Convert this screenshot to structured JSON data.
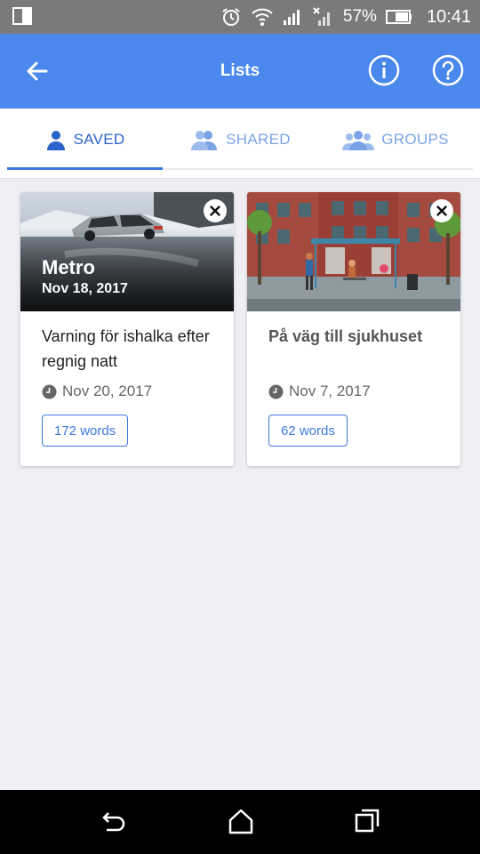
{
  "status_bar": {
    "battery": "57%",
    "time": "10:41"
  },
  "app_bar": {
    "title": "Lists"
  },
  "tabs": [
    {
      "label": "SAVED",
      "active": true
    },
    {
      "label": "SHARED",
      "active": false
    },
    {
      "label": "GROUPS",
      "active": false
    }
  ],
  "cards": [
    {
      "source": "Metro",
      "source_date": "Nov 18, 2017",
      "title": "Varning för ishalka efter regnig natt",
      "date": "Nov 20, 2017",
      "words": "172 words"
    },
    {
      "title": "På väg till sjukhuset",
      "date": "Nov 7, 2017",
      "words": "62 words"
    }
  ],
  "colors": {
    "accent": "#4a88ee",
    "tab_active": "#2c63c9",
    "tab_inactive": "#7aa3e6"
  }
}
